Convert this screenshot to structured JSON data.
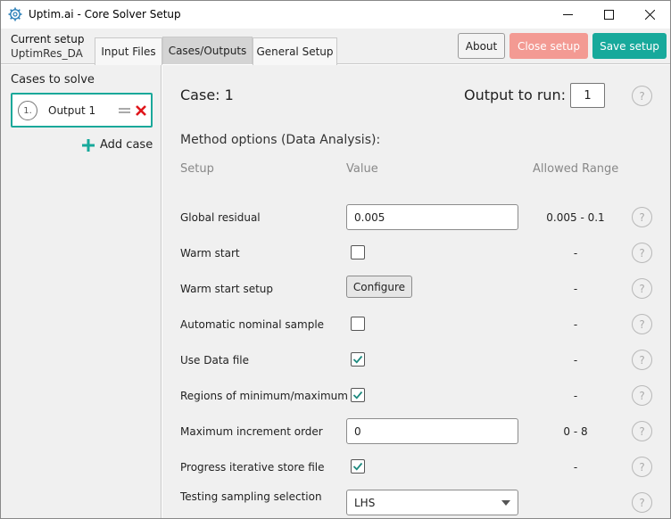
{
  "window": {
    "title": "Uptim.ai - Core Solver Setup"
  },
  "toolbar": {
    "current_label": "Current setup",
    "current_name": "UptimRes_DA",
    "tabs": [
      {
        "label": "Input Files"
      },
      {
        "label": "Cases/Outputs"
      },
      {
        "label": "General Setup"
      }
    ],
    "active_tab": "Cases/Outputs",
    "about_label": "About",
    "close_label": "Close setup",
    "save_label": "Save setup"
  },
  "sidebar": {
    "title": "Cases to solve",
    "cases": [
      {
        "number": "1.",
        "label": "Output 1"
      }
    ],
    "add_label": "Add case"
  },
  "main": {
    "case_title": "Case: 1",
    "output_label": "Output to run:",
    "output_value": "1",
    "help_glyph": "?",
    "section_title": "Method options (Data Analysis):",
    "columns": {
      "setup": "Setup",
      "value": "Value",
      "range": "Allowed Range"
    },
    "rows": [
      {
        "label": "Global residual",
        "type": "input",
        "value": "0.005",
        "range": "0.005 - 0.1"
      },
      {
        "label": "Warm start",
        "type": "checkbox",
        "checked": false,
        "range": "-"
      },
      {
        "label": "Warm start setup",
        "type": "button",
        "value": "Configure",
        "range": "-"
      },
      {
        "label": "Automatic nominal sample",
        "type": "checkbox",
        "checked": false,
        "range": "-"
      },
      {
        "label": "Use Data file",
        "type": "checkbox",
        "checked": true,
        "range": "-"
      },
      {
        "label": "Regions of minimum/maximum",
        "type": "checkbox",
        "checked": true,
        "range": "-"
      },
      {
        "label": "Maximum increment order",
        "type": "input",
        "value": "0",
        "range": "0 - 8"
      },
      {
        "label": "Progress iterative store file",
        "type": "checkbox",
        "checked": true,
        "range": "-"
      },
      {
        "label": "Testing sampling selection",
        "type": "select",
        "value": "LHS",
        "range": ""
      }
    ]
  },
  "colors": {
    "accent": "#17a99b",
    "close_button": "#f39a93",
    "delete": "#e0161b",
    "check": "#1e8a7f"
  }
}
